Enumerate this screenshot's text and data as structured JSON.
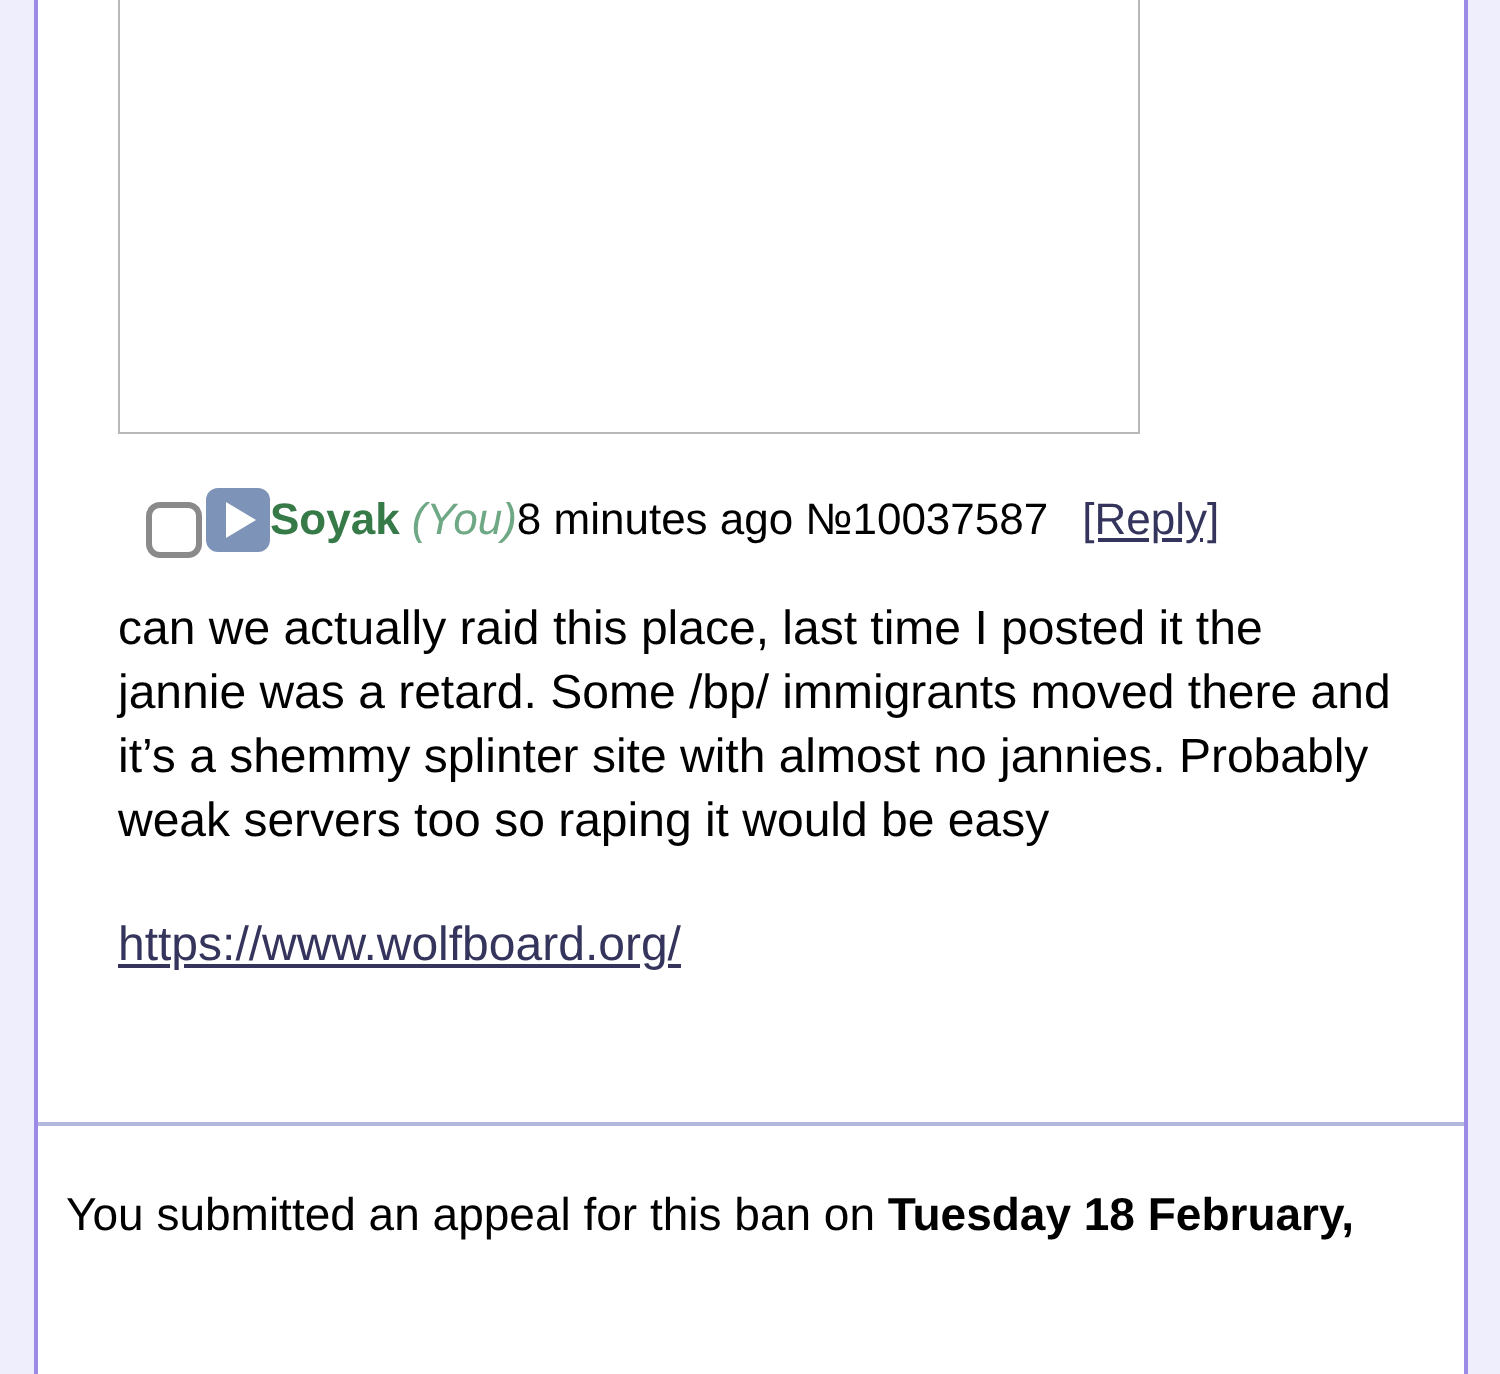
{
  "post": {
    "selected": false,
    "name": "Soyak",
    "you": "(You)",
    "time": "8 minutes ago",
    "number": "№10037587",
    "reply": "[Reply]",
    "body": "can we actually raid this place, last time I posted it the jannie was a retard. Some /bp/ immigrants moved there and it’s a shemmy splinter site with almost no jannies. Probably weak servers too so raping it would be easy",
    "link": "https://www.wolfboard.org/"
  },
  "appeal": "You submitted an appeal for this ban on **Tuesday 18 February,**"
}
